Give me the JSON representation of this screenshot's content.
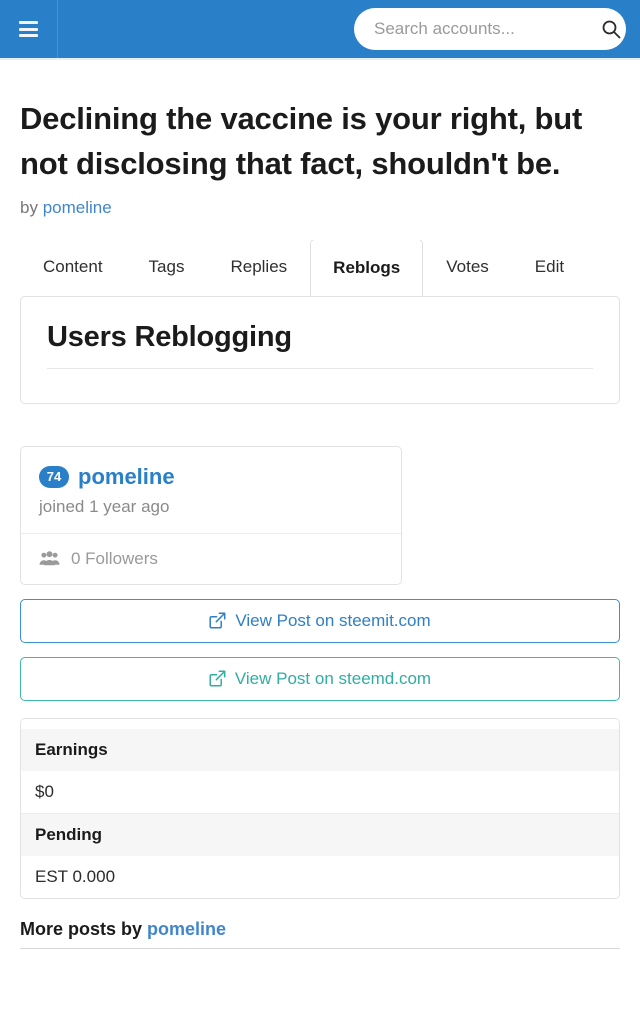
{
  "header": {
    "menu_icon": "hamburger-menu-icon",
    "search": {
      "placeholder": "Search accounts...",
      "value": "",
      "icon": "search-icon"
    },
    "background_color": "#2a80c8"
  },
  "post": {
    "title": "Declining the vaccine is your right, but not disclosing that fact, shouldn't be.",
    "by_label": "by",
    "author": "pomeline"
  },
  "tabs": [
    {
      "label": "Content",
      "active": false
    },
    {
      "label": "Tags",
      "active": false
    },
    {
      "label": "Replies",
      "active": false
    },
    {
      "label": "Reblogs",
      "active": true
    },
    {
      "label": "Votes",
      "active": false
    },
    {
      "label": "Edit",
      "active": false
    }
  ],
  "panel": {
    "heading": "Users Reblogging"
  },
  "user_card": {
    "reputation": "74",
    "username": "pomeline",
    "joined": "joined 1 year ago",
    "followers": "0 Followers",
    "followers_icon": "users-group-icon"
  },
  "buttons": [
    {
      "label": "View Post on steemit.com",
      "icon": "external-link-icon",
      "color": "#2f7fc6",
      "border_color": "#3b8fd4"
    },
    {
      "label": "View Post on steemd.com",
      "icon": "external-link-icon",
      "color": "#30ada4",
      "border_color": "#3fb8ae"
    }
  ],
  "earnings_table": {
    "rows": [
      {
        "header": "Earnings",
        "value": "$0"
      },
      {
        "header": "Pending",
        "value": "EST 0.000"
      }
    ]
  },
  "footer": {
    "more_posts_label": "More posts by",
    "author": "pomeline"
  }
}
